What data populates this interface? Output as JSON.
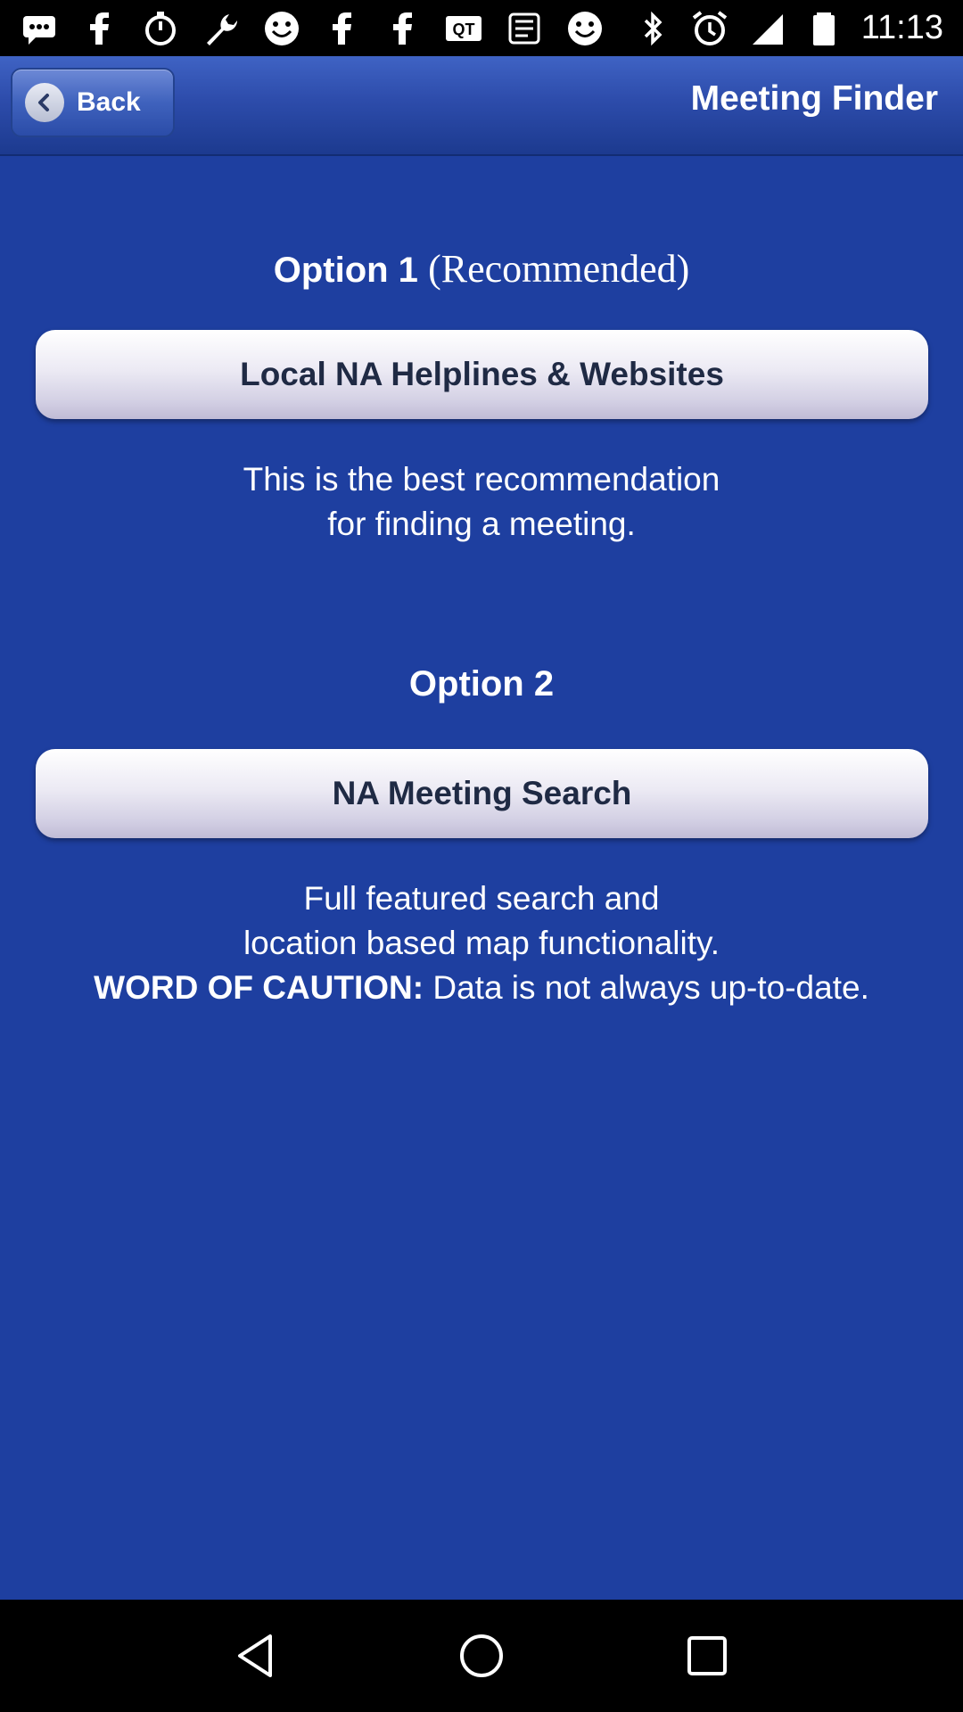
{
  "status_bar": {
    "time": "11:13",
    "left_icons": [
      "messaging-icon",
      "facebook-icon",
      "timer-icon",
      "wrench-icon",
      "smiley-icon",
      "facebook-icon",
      "facebook-icon",
      "qt-icon",
      "app-icon",
      "smiley-icon"
    ],
    "right_icons": [
      "bluetooth-icon",
      "alarm-icon",
      "signal-icon",
      "battery-icon"
    ]
  },
  "header": {
    "back_label": "Back",
    "title": "Meeting Finder"
  },
  "option1": {
    "label_bold": "Option 1",
    "label_suffix": "(Recommended)",
    "button_label": "Local NA Helplines & Websites",
    "desc_line1": "This is the best recommendation",
    "desc_line2": "for finding a meeting."
  },
  "option2": {
    "label": "Option 2",
    "button_label": "NA Meeting Search",
    "desc_line1": "Full featured search and",
    "desc_line2": "location based map functionality.",
    "caution_label": "WORD OF CAUTION:",
    "caution_text": "Data is not always up-to-date."
  },
  "colors": {
    "background": "#1e3fa0",
    "nav_bar": "#2d4cab",
    "button_text": "#1f2a44"
  }
}
